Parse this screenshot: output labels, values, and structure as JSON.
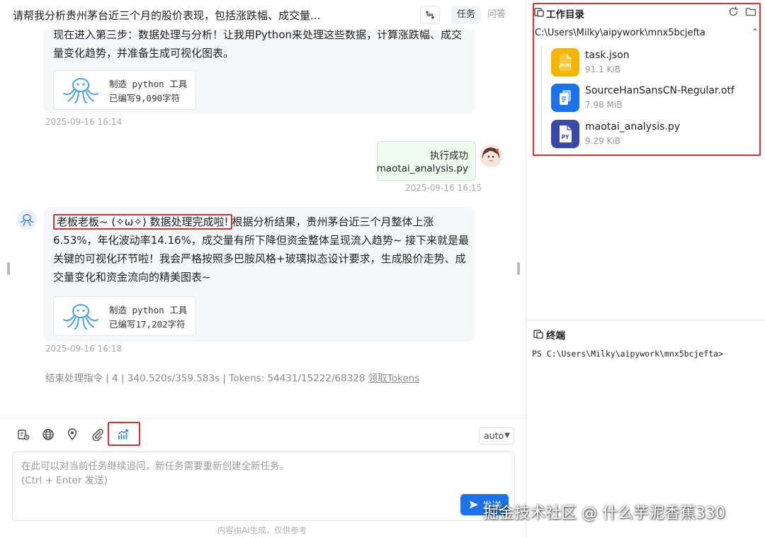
{
  "header": {
    "title": "请帮我分析贵州茅台近三个月的股价表现，包括涨跌幅、成交量...",
    "tabs": [
      {
        "label": "任务"
      },
      {
        "label": "问答"
      }
    ]
  },
  "chat": {
    "messages": [
      {
        "text": "现在进入第三步：数据处理与分析！让我用Python来处理这些数据，计算涨跌幅、成交量变化趋势，并准备生成可视化图表。",
        "tool_title": "制造 python 工具",
        "tool_detail": "已编写9,090字符",
        "time": "2025-09-16 16:14"
      },
      {
        "user_line1": "执行成功",
        "user_line2": "maotai_analysis.py",
        "time": "2025-09-16 16:15"
      },
      {
        "highlight": "老板老板~ (✧ω✧) 数据处理完成啦!",
        "text": "根据分析结果，贵州茅台近三个月整体上涨6.53%，年化波动率14.16%，成交量有所下降但资金整体呈现流入趋势~ 接下来就是最关键的可视化环节啦！我会严格按照多巴胺风格+玻璃拟态设计要求，生成股价走势、成交量变化和资金流向的精美图表~",
        "tool_title": "制造 python 工具",
        "tool_detail": "已编写17,202字符",
        "time": "2025-09-16 16:18"
      }
    ],
    "stats": "结束处理指令 | 4 | 340.520s/359.583s | Tokens: 54431/15222/68328",
    "stats_link": "领取Tokens"
  },
  "toolbar": {
    "mode": "auto",
    "icons": [
      "task-icon",
      "globe-icon",
      "location-pin-icon",
      "paperclip-icon",
      "chart-trend-icon"
    ]
  },
  "input": {
    "placeholder": "在此可以对当前任务继续追问，新任务需要重新创建全新任务。\n(Ctrl + Enter 发送)",
    "send_label": "发送"
  },
  "disclaimer": "内容由AI生成，仅供参考",
  "workdir": {
    "title": "工作目录",
    "path": "C:\\Users\\Milky\\aipywork\\mnx5bcjefta",
    "files": [
      {
        "name": "task.json",
        "size": "91.1 KiB",
        "type": "JSON",
        "color": "#f5b400"
      },
      {
        "name": "SourceHanSansCN-Regular.otf",
        "size": "7.98 MiB",
        "type": "",
        "color": "#1a73e8"
      },
      {
        "name": "maotai_analysis.py",
        "size": "9.29 KiB",
        "type": "PY",
        "color": "#3949ab"
      }
    ]
  },
  "terminal": {
    "title": "终端",
    "line": "PS C:\\Users\\Milky\\aipywork\\mnx5bcjefta>"
  },
  "watermark": "掘金技术社区 @ 什么芋泥香蕉330",
  "colors": {
    "accent": "#1a73e8",
    "highlight_border": "#d93030",
    "user_bubble": "#eefbef"
  }
}
